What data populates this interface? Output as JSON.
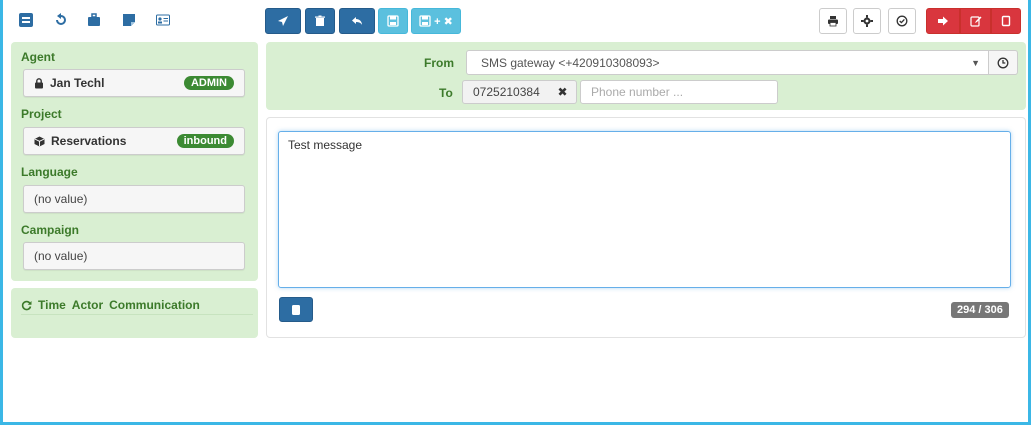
{
  "toolbar": {
    "nav_icons": [
      "message-icon",
      "history-icon",
      "briefcase-icon",
      "note-icon",
      "contact-card-icon"
    ],
    "actions": [
      "send-icon",
      "trash-icon",
      "reply-icon",
      "save-icon"
    ],
    "save_close_label": "+ ✖",
    "right_icons": [
      "print-icon",
      "gear-icon",
      "check-circle-icon",
      "sign-out-icon",
      "edit-icon",
      "window-icon"
    ]
  },
  "sidebar": {
    "agent": {
      "label": "Agent",
      "value": "Jan Techl",
      "badge": "ADMIN"
    },
    "project": {
      "label": "Project",
      "value": "Reservations",
      "badge": "inbound"
    },
    "language": {
      "label": "Language",
      "value": "(no value)"
    },
    "campaign": {
      "label": "Campaign",
      "value": "(no value)"
    },
    "history": {
      "col1": "Time",
      "col2": "Actor",
      "col3": "Communication"
    }
  },
  "header": {
    "from_label": "From",
    "from_value": "SMS gateway <+420910308093>",
    "to_label": "To",
    "to_value": "0725210384",
    "remove_symbol": "✖",
    "phone_placeholder": "Phone number ..."
  },
  "message": {
    "text": "Test message",
    "counter": "294 / 306"
  },
  "colors": {
    "accent_dark": "#2d6da3",
    "accent_light": "#5bc0de",
    "danger": "#d9363e",
    "panel_green": "#d9efd2",
    "label_green": "#3c7a2a",
    "badge_green": "#3c8a33",
    "frame": "#3bb7e6"
  }
}
